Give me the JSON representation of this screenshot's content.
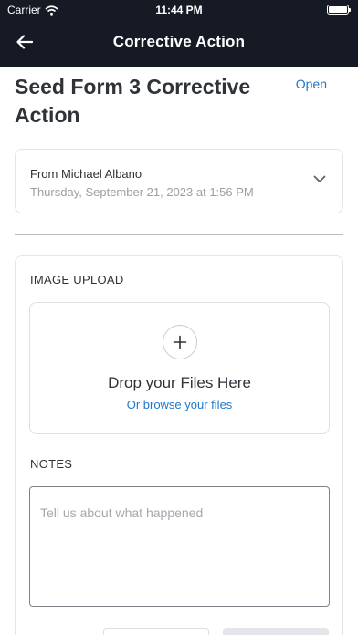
{
  "status_bar": {
    "carrier": "Carrier",
    "time": "11:44 PM",
    "battery_level": 1.0,
    "wifi_icon": "wifi-icon",
    "battery_icon": "battery-icon"
  },
  "nav": {
    "title": "Corrective Action",
    "back_icon": "arrow-left-icon"
  },
  "form": {
    "title": "Seed Form 3 Corrective Action",
    "status": "Open",
    "from": "From Michael Albano",
    "date": "Thursday, September 21, 2023 at 1:56 PM",
    "expand_icon": "chevron-down-icon"
  },
  "image_upload": {
    "label": "IMAGE UPLOAD",
    "drop_text": "Drop your Files Here",
    "browse_text": "Or browse your files",
    "add_icon": "plus-icon"
  },
  "notes": {
    "label": "NOTES",
    "value": "",
    "placeholder": "Tell us about what happened"
  },
  "colors": {
    "header_bg": "#161a24",
    "accent": "#1f78c8",
    "text": "#2f3338",
    "muted": "#9aa0a6"
  }
}
